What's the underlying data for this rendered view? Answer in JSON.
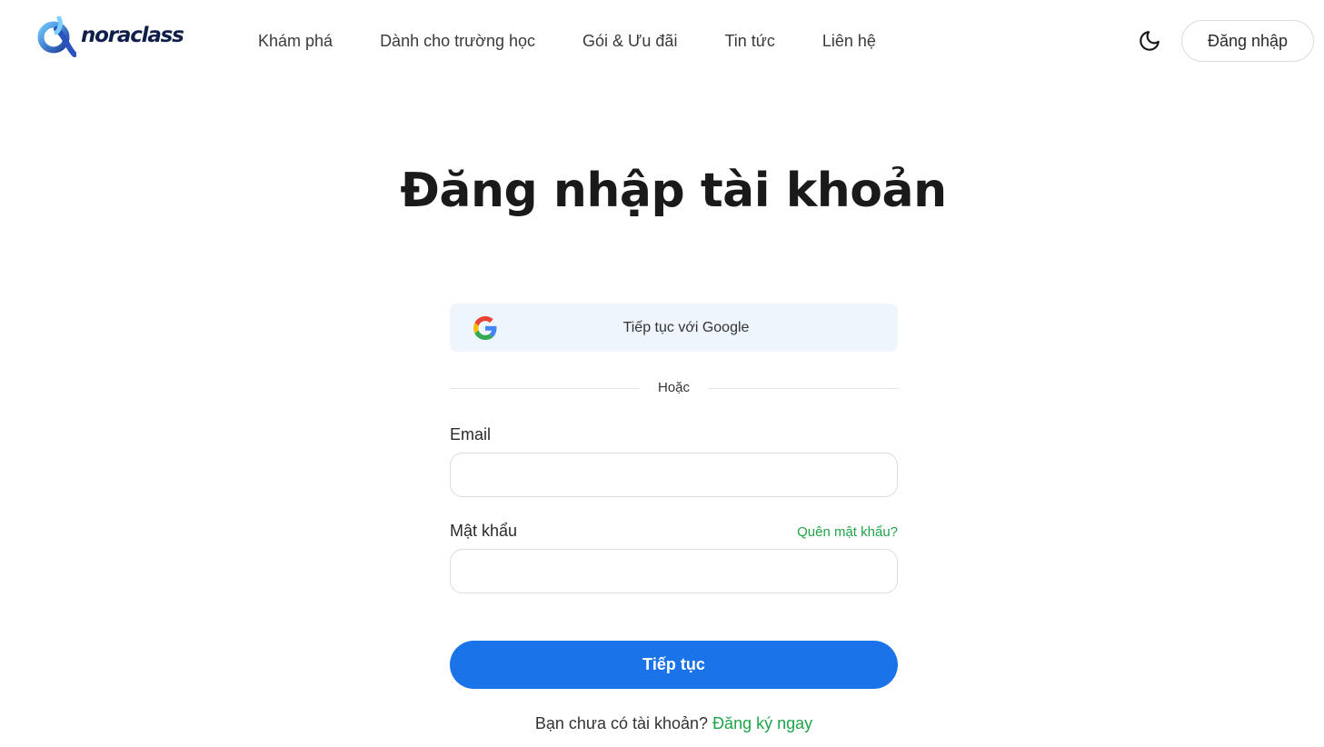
{
  "header": {
    "logo_text": "noraclass",
    "nav": [
      {
        "label": "Khám phá"
      },
      {
        "label": "Dành cho trường học"
      },
      {
        "label": "Gói & Ưu đãi"
      },
      {
        "label": "Tin tức"
      },
      {
        "label": "Liên hệ"
      }
    ],
    "theme_icon": "moon-icon",
    "login_label": "Đăng nhập"
  },
  "main": {
    "title": "Đăng nhập tài khoản",
    "google_label": "Tiếp tục với Google",
    "divider_text": "Hoặc",
    "email": {
      "label": "Email",
      "value": "",
      "placeholder": ""
    },
    "password": {
      "label": "Mật khẩu",
      "value": "",
      "placeholder": "",
      "forgot_label": "Quên mật khẩu?"
    },
    "submit_label": "Tiếp tục",
    "signup_prompt": "Bạn chưa có tài khoản?",
    "signup_link": "Đăng ký ngay"
  },
  "colors": {
    "primary": "#1a73e8",
    "link_green": "#1fa44a",
    "google_bg": "#eef5fd",
    "logo_navy": "#101e4a"
  }
}
